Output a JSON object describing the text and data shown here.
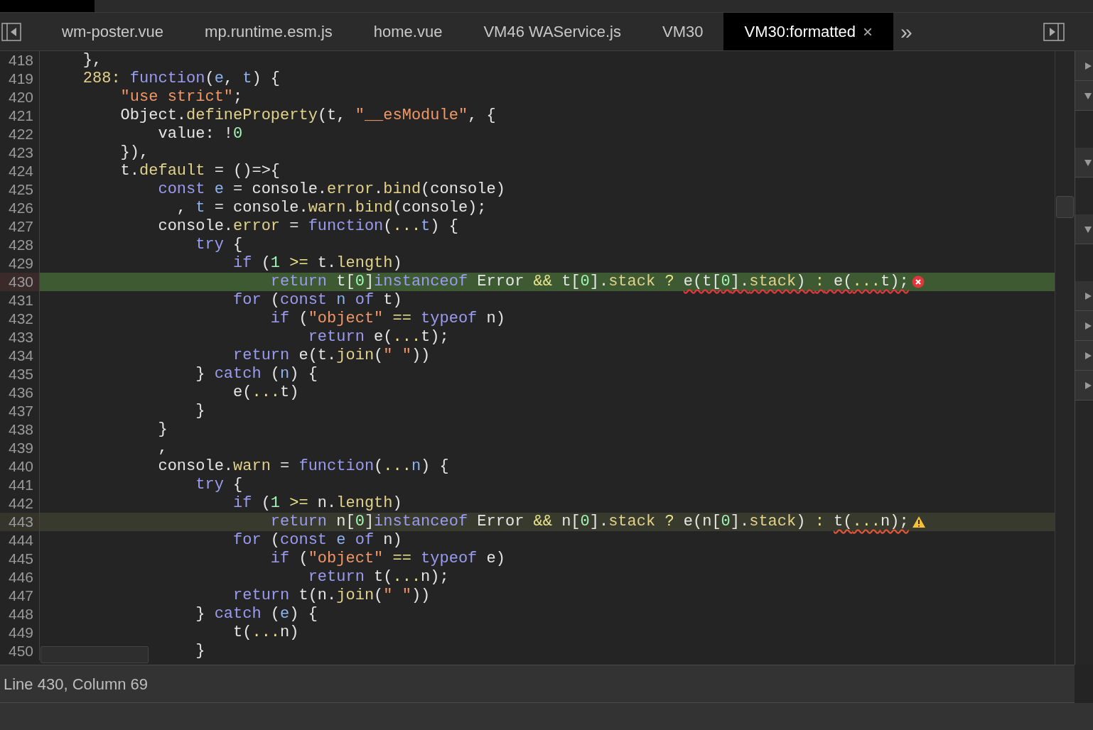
{
  "tabs": [
    {
      "label": "wm-poster.vue",
      "selected": false
    },
    {
      "label": "mp.runtime.esm.js",
      "selected": false
    },
    {
      "label": "home.vue",
      "selected": false
    },
    {
      "label": "VM46 WAService.js",
      "selected": false
    },
    {
      "label": "VM30",
      "selected": false
    },
    {
      "label": "VM30:formatted",
      "selected": true,
      "close": "×"
    }
  ],
  "more_tabs": "»",
  "code_lines": [
    {
      "number": "418",
      "tokens": [
        {
          "text": "    },",
          "kind": "plain"
        }
      ]
    },
    {
      "number": "419",
      "tokens": [
        {
          "text": "    288:",
          "kind": "prop"
        },
        {
          "text": " function",
          "kind": "keyword"
        },
        {
          "text": "(",
          "kind": "plain"
        },
        {
          "text": "e",
          "kind": "var"
        },
        {
          "text": ", ",
          "kind": "plain"
        },
        {
          "text": "t",
          "kind": "var"
        },
        {
          "text": ") {",
          "kind": "plain"
        }
      ]
    },
    {
      "number": "420",
      "tokens": [
        {
          "text": "        \"use strict\"",
          "kind": "string"
        },
        {
          "text": ";",
          "kind": "plain"
        }
      ]
    },
    {
      "number": "421",
      "tokens": [
        {
          "text": "        Object.",
          "kind": "plain"
        },
        {
          "text": "defineProperty",
          "kind": "prop"
        },
        {
          "text": "(t, ",
          "kind": "plain"
        },
        {
          "text": "\"__esModule\"",
          "kind": "string"
        },
        {
          "text": ", {",
          "kind": "plain"
        }
      ]
    },
    {
      "number": "422",
      "tokens": [
        {
          "text": "            value: !",
          "kind": "plain"
        },
        {
          "text": "0",
          "kind": "number"
        }
      ]
    },
    {
      "number": "423",
      "tokens": [
        {
          "text": "        }),",
          "kind": "plain"
        }
      ]
    },
    {
      "number": "424",
      "tokens": [
        {
          "text": "        t.",
          "kind": "plain"
        },
        {
          "text": "default",
          "kind": "prop"
        },
        {
          "text": " = ()=>{",
          "kind": "plain"
        }
      ]
    },
    {
      "number": "425",
      "tokens": [
        {
          "text": "            const",
          "kind": "keyword"
        },
        {
          "text": " e",
          "kind": "var"
        },
        {
          "text": " = console.",
          "kind": "plain"
        },
        {
          "text": "error",
          "kind": "prop"
        },
        {
          "text": ".",
          "kind": "plain"
        },
        {
          "text": "bind",
          "kind": "prop"
        },
        {
          "text": "(console)",
          "kind": "plain"
        }
      ]
    },
    {
      "number": "426",
      "tokens": [
        {
          "text": "              , ",
          "kind": "plain"
        },
        {
          "text": "t",
          "kind": "var"
        },
        {
          "text": " = console.",
          "kind": "plain"
        },
        {
          "text": "warn",
          "kind": "prop"
        },
        {
          "text": ".",
          "kind": "plain"
        },
        {
          "text": "bind",
          "kind": "prop"
        },
        {
          "text": "(console);",
          "kind": "plain"
        }
      ]
    },
    {
      "number": "427",
      "tokens": [
        {
          "text": "            console.",
          "kind": "plain"
        },
        {
          "text": "error",
          "kind": "prop"
        },
        {
          "text": " = ",
          "kind": "plain"
        },
        {
          "text": "function",
          "kind": "keyword"
        },
        {
          "text": "(",
          "kind": "plain"
        },
        {
          "text": "...",
          "kind": "op"
        },
        {
          "text": "t",
          "kind": "var"
        },
        {
          "text": ") {",
          "kind": "plain"
        }
      ]
    },
    {
      "number": "428",
      "tokens": [
        {
          "text": "                try",
          "kind": "keyword"
        },
        {
          "text": " {",
          "kind": "plain"
        }
      ]
    },
    {
      "number": "429",
      "tokens": [
        {
          "text": "                    if",
          "kind": "keyword"
        },
        {
          "text": " (",
          "kind": "plain"
        },
        {
          "text": "1",
          "kind": "number"
        },
        {
          "text": " >=",
          "kind": "op"
        },
        {
          "text": " t.",
          "kind": "plain"
        },
        {
          "text": "length",
          "kind": "prop"
        },
        {
          "text": ")",
          "kind": "plain"
        }
      ]
    },
    {
      "number": "430",
      "error": true,
      "tokens": [
        {
          "text": "                        return",
          "kind": "keyword"
        },
        {
          "text": " t[",
          "kind": "plain"
        },
        {
          "text": "0",
          "kind": "number"
        },
        {
          "text": "]",
          "kind": "plain"
        },
        {
          "text": "instanceof",
          "kind": "keyword"
        },
        {
          "text": " Error ",
          "kind": "plain"
        },
        {
          "text": "&&",
          "kind": "op"
        },
        {
          "text": " t[",
          "kind": "plain"
        },
        {
          "text": "0",
          "kind": "number"
        },
        {
          "text": "].",
          "kind": "plain"
        },
        {
          "text": "stack",
          "kind": "prop"
        },
        {
          "text": " ? ",
          "kind": "op"
        }
      ],
      "underlined": [
        {
          "text": "e(t[",
          "kind": "plain"
        },
        {
          "text": "0",
          "kind": "number"
        },
        {
          "text": "].",
          "kind": "plain"
        },
        {
          "text": "stack",
          "kind": "prop"
        },
        {
          "text": ") ",
          "kind": "plain"
        },
        {
          "text": ":",
          "kind": "op"
        },
        {
          "text": " e(",
          "kind": "plain"
        },
        {
          "text": "...",
          "kind": "op"
        },
        {
          "text": "t);",
          "kind": "plain"
        }
      ]
    },
    {
      "number": "431",
      "tokens": [
        {
          "text": "                    for",
          "kind": "keyword"
        },
        {
          "text": " (",
          "kind": "plain"
        },
        {
          "text": "const",
          "kind": "keyword"
        },
        {
          "text": " n",
          "kind": "var"
        },
        {
          "text": " of",
          "kind": "keyword"
        },
        {
          "text": " t)",
          "kind": "plain"
        }
      ]
    },
    {
      "number": "432",
      "tokens": [
        {
          "text": "                        if",
          "kind": "keyword"
        },
        {
          "text": " (",
          "kind": "plain"
        },
        {
          "text": "\"object\"",
          "kind": "string"
        },
        {
          "text": " ==",
          "kind": "op"
        },
        {
          "text": " typeof",
          "kind": "keyword"
        },
        {
          "text": " n)",
          "kind": "plain"
        }
      ]
    },
    {
      "number": "433",
      "tokens": [
        {
          "text": "                            return",
          "kind": "keyword"
        },
        {
          "text": " e(",
          "kind": "plain"
        },
        {
          "text": "...",
          "kind": "op"
        },
        {
          "text": "t);",
          "kind": "plain"
        }
      ]
    },
    {
      "number": "434",
      "tokens": [
        {
          "text": "                    return",
          "kind": "keyword"
        },
        {
          "text": " e(t.",
          "kind": "plain"
        },
        {
          "text": "join",
          "kind": "prop"
        },
        {
          "text": "(",
          "kind": "plain"
        },
        {
          "text": "\" \"",
          "kind": "string"
        },
        {
          "text": "))",
          "kind": "plain"
        }
      ]
    },
    {
      "number": "435",
      "tokens": [
        {
          "text": "                } ",
          "kind": "plain"
        },
        {
          "text": "catch",
          "kind": "keyword"
        },
        {
          "text": " (",
          "kind": "plain"
        },
        {
          "text": "n",
          "kind": "var"
        },
        {
          "text": ") {",
          "kind": "plain"
        }
      ]
    },
    {
      "number": "436",
      "tokens": [
        {
          "text": "                    e(",
          "kind": "plain"
        },
        {
          "text": "...",
          "kind": "op"
        },
        {
          "text": "t)",
          "kind": "plain"
        }
      ]
    },
    {
      "number": "437",
      "tokens": [
        {
          "text": "                }",
          "kind": "plain"
        }
      ]
    },
    {
      "number": "438",
      "tokens": [
        {
          "text": "            }",
          "kind": "plain"
        }
      ]
    },
    {
      "number": "439",
      "tokens": [
        {
          "text": "            ,",
          "kind": "plain"
        }
      ]
    },
    {
      "number": "440",
      "tokens": [
        {
          "text": "            console.",
          "kind": "plain"
        },
        {
          "text": "warn",
          "kind": "prop"
        },
        {
          "text": " = ",
          "kind": "plain"
        },
        {
          "text": "function",
          "kind": "keyword"
        },
        {
          "text": "(",
          "kind": "plain"
        },
        {
          "text": "...",
          "kind": "op"
        },
        {
          "text": "n",
          "kind": "var"
        },
        {
          "text": ") {",
          "kind": "plain"
        }
      ]
    },
    {
      "number": "441",
      "tokens": [
        {
          "text": "                try",
          "kind": "keyword"
        },
        {
          "text": " {",
          "kind": "plain"
        }
      ]
    },
    {
      "number": "442",
      "tokens": [
        {
          "text": "                    if",
          "kind": "keyword"
        },
        {
          "text": " (",
          "kind": "plain"
        },
        {
          "text": "1",
          "kind": "number"
        },
        {
          "text": " >=",
          "kind": "op"
        },
        {
          "text": " n.",
          "kind": "plain"
        },
        {
          "text": "length",
          "kind": "prop"
        },
        {
          "text": ")",
          "kind": "plain"
        }
      ]
    },
    {
      "number": "443",
      "warning": true,
      "tokens": [
        {
          "text": "                        return",
          "kind": "keyword"
        },
        {
          "text": " n[",
          "kind": "plain"
        },
        {
          "text": "0",
          "kind": "number"
        },
        {
          "text": "]",
          "kind": "plain"
        },
        {
          "text": "instanceof",
          "kind": "keyword"
        },
        {
          "text": " Error ",
          "kind": "plain"
        },
        {
          "text": "&&",
          "kind": "op"
        },
        {
          "text": " n[",
          "kind": "plain"
        },
        {
          "text": "0",
          "kind": "number"
        },
        {
          "text": "].",
          "kind": "plain"
        },
        {
          "text": "stack",
          "kind": "prop"
        },
        {
          "text": " ?",
          "kind": "op"
        },
        {
          "text": " e(n[",
          "kind": "plain"
        },
        {
          "text": "0",
          "kind": "number"
        },
        {
          "text": "].",
          "kind": "plain"
        },
        {
          "text": "stack",
          "kind": "prop"
        },
        {
          "text": ") ",
          "kind": "plain"
        },
        {
          "text": ": ",
          "kind": "op"
        }
      ],
      "underlined": [
        {
          "text": "t(",
          "kind": "plain"
        },
        {
          "text": "...",
          "kind": "op"
        },
        {
          "text": "n);",
          "kind": "plain"
        }
      ]
    },
    {
      "number": "444",
      "tokens": [
        {
          "text": "                    for",
          "kind": "keyword"
        },
        {
          "text": " (",
          "kind": "plain"
        },
        {
          "text": "const",
          "kind": "keyword"
        },
        {
          "text": " e",
          "kind": "var"
        },
        {
          "text": " of",
          "kind": "keyword"
        },
        {
          "text": " n)",
          "kind": "plain"
        }
      ]
    },
    {
      "number": "445",
      "tokens": [
        {
          "text": "                        if",
          "kind": "keyword"
        },
        {
          "text": " (",
          "kind": "plain"
        },
        {
          "text": "\"object\"",
          "kind": "string"
        },
        {
          "text": " ==",
          "kind": "op"
        },
        {
          "text": " typeof",
          "kind": "keyword"
        },
        {
          "text": " e)",
          "kind": "plain"
        }
      ]
    },
    {
      "number": "446",
      "tokens": [
        {
          "text": "                            return",
          "kind": "keyword"
        },
        {
          "text": " t(",
          "kind": "plain"
        },
        {
          "text": "...",
          "kind": "op"
        },
        {
          "text": "n);",
          "kind": "plain"
        }
      ]
    },
    {
      "number": "447",
      "tokens": [
        {
          "text": "                    return",
          "kind": "keyword"
        },
        {
          "text": " t(n.",
          "kind": "plain"
        },
        {
          "text": "join",
          "kind": "prop"
        },
        {
          "text": "(",
          "kind": "plain"
        },
        {
          "text": "\" \"",
          "kind": "string"
        },
        {
          "text": "))",
          "kind": "plain"
        }
      ]
    },
    {
      "number": "448",
      "tokens": [
        {
          "text": "                } ",
          "kind": "plain"
        },
        {
          "text": "catch",
          "kind": "keyword"
        },
        {
          "text": " (",
          "kind": "plain"
        },
        {
          "text": "e",
          "kind": "var"
        },
        {
          "text": ") {",
          "kind": "plain"
        }
      ]
    },
    {
      "number": "449",
      "tokens": [
        {
          "text": "                    t(",
          "kind": "plain"
        },
        {
          "text": "...",
          "kind": "op"
        },
        {
          "text": "n)",
          "kind": "plain"
        }
      ]
    },
    {
      "number": "450",
      "tokens": [
        {
          "text": "                }",
          "kind": "plain"
        }
      ]
    }
  ],
  "status_bar": "Line 430, Column 69"
}
